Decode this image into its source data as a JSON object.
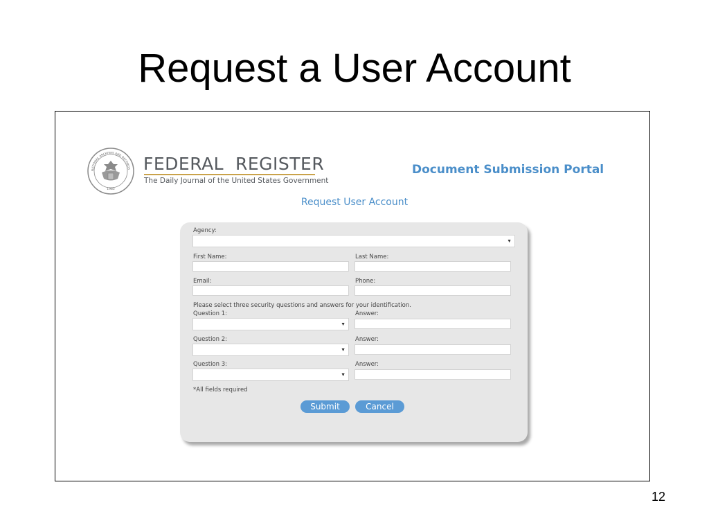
{
  "slide": {
    "title": "Request a User Account",
    "page_number": "12"
  },
  "header": {
    "brand_name": "FEDERAL  REGISTER",
    "brand_tagline": "The Daily Journal of the United States Government",
    "seal_text": "NATIONAL ARCHIVES AND RECORDS ADMINISTRATION",
    "seal_year": "1985",
    "portal_title": "Document Submission Portal"
  },
  "form": {
    "heading": "Request User Account",
    "agency_label": "Agency:",
    "agency_value": "",
    "first_name_label": "First Name:",
    "first_name_value": "",
    "last_name_label": "Last Name:",
    "last_name_value": "",
    "email_label": "Email:",
    "email_value": "",
    "phone_label": "Phone:",
    "phone_value": "",
    "security_instructions": "Please select three security questions and answers for your identification.",
    "questions": [
      {
        "question_label": "Question 1:",
        "answer_label": "Answer:",
        "question_value": "",
        "answer_value": ""
      },
      {
        "question_label": "Question 2:",
        "answer_label": "Answer:",
        "question_value": "",
        "answer_value": ""
      },
      {
        "question_label": "Question 3:",
        "answer_label": "Answer:",
        "question_value": "",
        "answer_value": ""
      }
    ],
    "required_note": "*All fields required",
    "submit_label": "Submit",
    "cancel_label": "Cancel"
  },
  "icons": {
    "select_caret": "caret-down-icon",
    "seal": "agency-seal-icon"
  },
  "colors": {
    "accent": "#4a8ec9",
    "button": "#5b9bd5",
    "panel": "#e7e7e7",
    "brand_rule": "#c9a24a"
  }
}
